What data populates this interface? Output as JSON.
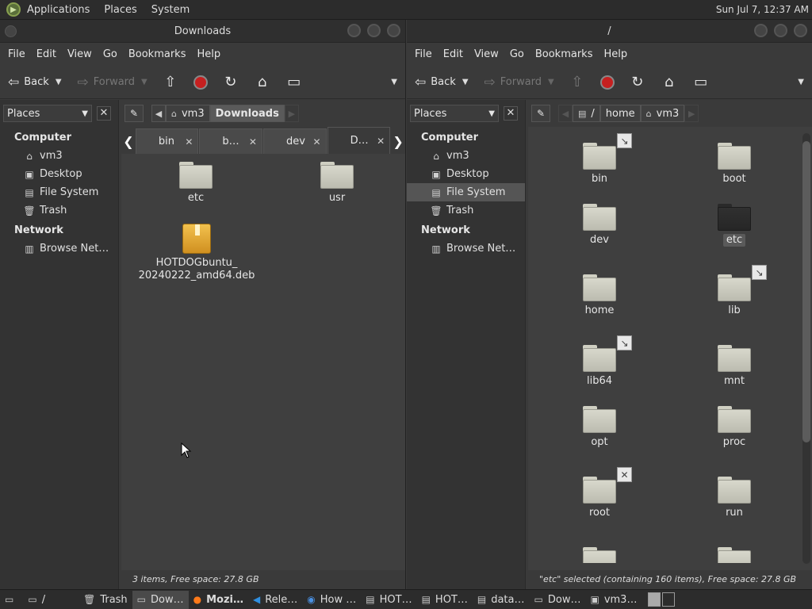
{
  "top_panel": {
    "menus": [
      "Applications",
      "Places",
      "System"
    ],
    "clock": "Sun Jul  7, 12:37 AM"
  },
  "left_window": {
    "title": "Downloads",
    "menus": [
      "File",
      "Edit",
      "View",
      "Go",
      "Bookmarks",
      "Help"
    ],
    "toolbar": {
      "back": "Back",
      "forward": "Forward"
    },
    "sidebar": {
      "selector": "Places",
      "computer_label": "Computer",
      "items": [
        "vm3",
        "Desktop",
        "File System",
        "Trash"
      ],
      "network_label": "Network",
      "network_items": [
        "Browse Net…"
      ]
    },
    "path": [
      "vm3",
      "Downloads"
    ],
    "tabs": [
      "bin",
      "b…",
      "dev",
      "D…"
    ],
    "files": [
      {
        "name": "etc",
        "type": "folder"
      },
      {
        "name": "usr",
        "type": "folder"
      },
      {
        "name": "HOTDOGbuntu_\n20240222_amd64.deb",
        "type": "package"
      }
    ],
    "status": "3 items, Free space: 27.8 GB"
  },
  "right_window": {
    "title": "/",
    "menus": [
      "File",
      "Edit",
      "View",
      "Go",
      "Bookmarks",
      "Help"
    ],
    "toolbar": {
      "back": "Back",
      "forward": "Forward"
    },
    "sidebar": {
      "selector": "Places",
      "computer_label": "Computer",
      "items": [
        "vm3",
        "Desktop",
        "File System",
        "Trash"
      ],
      "network_label": "Network",
      "network_items": [
        "Browse Net…"
      ]
    },
    "path": [
      "/",
      "home",
      "vm3"
    ],
    "files": [
      {
        "name": "bin",
        "emblem": "link"
      },
      {
        "name": "boot",
        "emblem": ""
      },
      {
        "name": "dev",
        "emblem": ""
      },
      {
        "name": "etc",
        "emblem": "",
        "selected": true
      },
      {
        "name": "home",
        "emblem": ""
      },
      {
        "name": "lib",
        "emblem": "link"
      },
      {
        "name": "lib64",
        "emblem": "link"
      },
      {
        "name": "mnt",
        "emblem": ""
      },
      {
        "name": "opt",
        "emblem": ""
      },
      {
        "name": "proc",
        "emblem": ""
      },
      {
        "name": "root",
        "emblem": "locked"
      },
      {
        "name": "run",
        "emblem": ""
      }
    ],
    "status": "\"etc\" selected (containing 160 items), Free space: 27.8 GB"
  },
  "taskbar": {
    "items": [
      "/",
      "Trash",
      "Dow…",
      "Mozi…",
      "Rele…",
      "How …",
      "HOT…",
      "HOT…",
      "data…",
      "Dow…",
      "vm3…"
    ]
  }
}
